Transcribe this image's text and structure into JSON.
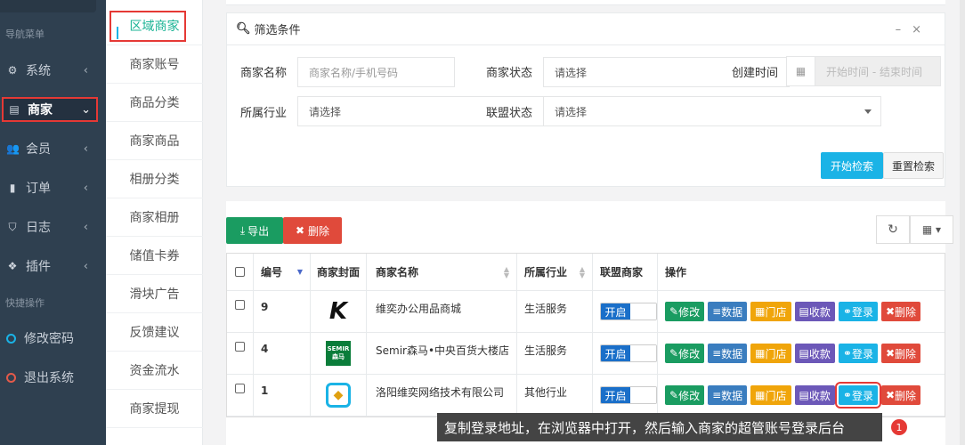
{
  "sidebar": {
    "section_nav": "导航菜单",
    "section_quick": "快捷操作",
    "items": [
      {
        "label": "系统",
        "icon": "gear-icon"
      },
      {
        "label": "商家",
        "icon": "briefcase-icon"
      },
      {
        "label": "会员",
        "icon": "users-icon"
      },
      {
        "label": "订单",
        "icon": "bookmark-icon"
      },
      {
        "label": "日志",
        "icon": "shield-icon"
      },
      {
        "label": "插件",
        "icon": "cubes-icon"
      }
    ],
    "quick": [
      {
        "label": "修改密码"
      },
      {
        "label": "退出系统"
      }
    ]
  },
  "submenu": {
    "items": [
      "区域商家",
      "商家账号",
      "商品分类",
      "商家商品",
      "相册分类",
      "商家相册",
      "储值卡券",
      "滑块广告",
      "反馈建议",
      "资金流水",
      "商家提现"
    ]
  },
  "filter": {
    "title": "筛选条件",
    "merchant_name_label": "商家名称",
    "merchant_name_placeholder": "商家名称/手机号码",
    "merchant_status_label": "商家状态",
    "merchant_status_value": "请选择",
    "created_label": "创建时间",
    "date_placeholder": "开始时间 - 结束时间",
    "industry_label": "所属行业",
    "industry_value": "请选择",
    "alliance_label": "联盟状态",
    "alliance_value": "请选择",
    "search_btn": "开始检索",
    "reset_btn": "重置检索"
  },
  "toolbar": {
    "export": "导出",
    "delete": "删除"
  },
  "table": {
    "headers": {
      "id": "编号",
      "cover": "商家封面",
      "name": "商家名称",
      "industry": "所属行业",
      "alliance": "联盟商家",
      "ops": "操作"
    },
    "rows": [
      {
        "id": "9",
        "name": "维奕办公用品商城",
        "industry": "生活服务",
        "switch": "开启"
      },
      {
        "id": "4",
        "name": "Semir森马•中央百货大楼店",
        "industry": "生活服务",
        "switch": "开启"
      },
      {
        "id": "1",
        "name": "洛阳维奕网络技术有限公司",
        "industry": "其他行业",
        "switch": "开启"
      }
    ],
    "ops": {
      "edit": "修改",
      "data": "数据",
      "store": "门店",
      "pay": "收款",
      "login": "登录",
      "del": "删除"
    }
  },
  "tooltip": {
    "text": "复制登录地址，在浏览器中打开，然后输入商家的超管账号登录后台",
    "badge": "1"
  },
  "logo_text": {
    "row2": "SEMIR\n森马"
  },
  "colors": {
    "sidebar": "#2f4050",
    "accent": "#1ab3e6",
    "green": "#1a9c61",
    "red": "#e04a3b",
    "orange": "#f0a50a",
    "purple": "#6c58b8",
    "blue": "#3a7dbf"
  }
}
